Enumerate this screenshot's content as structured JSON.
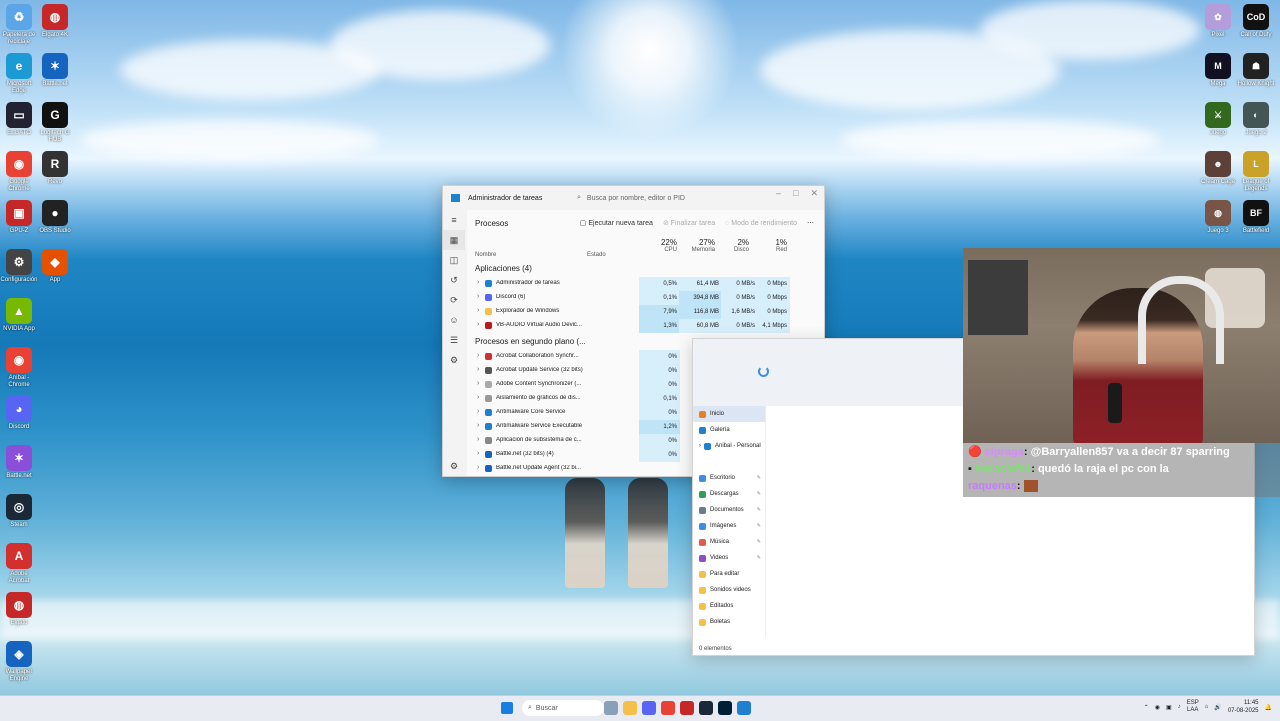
{
  "desktop": {
    "left_icons": [
      {
        "label": "Papelera de reciclaje",
        "color": "#5ba6e8",
        "glyph": "♻"
      },
      {
        "label": "Microsoft Edge",
        "color": "#1b9ad6",
        "glyph": "e"
      },
      {
        "label": "ELGATO",
        "color": "#223",
        "glyph": "▭"
      },
      {
        "label": "Google Chrome",
        "color": "#e94235",
        "glyph": "◉"
      },
      {
        "label": "GPU-Z",
        "color": "#c62828",
        "glyph": "▣"
      },
      {
        "label": "Configuración",
        "color": "#444",
        "glyph": "⚙"
      },
      {
        "label": "NVIDIA App",
        "color": "#76b900",
        "glyph": "▲"
      },
      {
        "label": "Aníbal - Chrome",
        "color": "#e94235",
        "glyph": "◉"
      },
      {
        "label": "Discord",
        "color": "#5865f2",
        "glyph": "◕"
      },
      {
        "label": "Battle.net",
        "color": "#8a4fd8",
        "glyph": "✶"
      },
      {
        "label": "Steam",
        "color": "#1b2838",
        "glyph": "◎"
      },
      {
        "label": "Adobe Acrobat",
        "color": "#d32f2f",
        "glyph": "A"
      },
      {
        "label": "Elgato",
        "color": "#c62828",
        "glyph": "◍"
      },
      {
        "label": "Wallpaper Engine",
        "color": "#1565c0",
        "glyph": "◈"
      }
    ],
    "left_icons_col2": [
      {
        "label": "Elgato 4K",
        "color": "#c62828",
        "glyph": "◍"
      },
      {
        "label": "Battle.net",
        "color": "#1565c0",
        "glyph": "✶"
      },
      {
        "label": "Logitech G HUB",
        "color": "#111",
        "glyph": "G"
      },
      {
        "label": "Revo",
        "color": "#333",
        "glyph": "R"
      },
      {
        "label": "OBS Studio",
        "color": "#222",
        "glyph": "●"
      },
      {
        "label": "App",
        "color": "#e65100",
        "glyph": "◆"
      }
    ],
    "right_icons": [
      {
        "label": "Pixel",
        "color": "#b39ddb",
        "glyph": "✿"
      },
      {
        "label": "Call of Duty",
        "color": "#111",
        "glyph": "CoD"
      },
      {
        "label": "Mega",
        "color": "#112",
        "glyph": "M"
      },
      {
        "label": "Hollow Knight",
        "color": "#222",
        "glyph": "☗"
      },
      {
        "label": "Juego",
        "color": "#33691e",
        "glyph": "⚔"
      },
      {
        "label": "Juego 2",
        "color": "#455",
        "glyph": "◐"
      },
      {
        "label": "Cream Cage",
        "color": "#5d4037",
        "glyph": "☻"
      },
      {
        "label": "League of Legends",
        "color": "#c9a227",
        "glyph": "L"
      },
      {
        "label": "Juego 3",
        "color": "#795548",
        "glyph": "◍"
      },
      {
        "label": "Battlefield",
        "color": "#111",
        "glyph": "BF"
      }
    ]
  },
  "task_manager": {
    "title": "Administrador de tareas",
    "search_placeholder": "Busca por nombre, editor o PID",
    "section": "Procesos",
    "toolbar": {
      "new_task": "Ejecutar nueva tarea",
      "end_task": "Finalizar tarea",
      "efficiency": "Modo de rendimiento",
      "more": "⋯"
    },
    "columns": {
      "name": "Nombre",
      "status": "Estado",
      "cpu": {
        "pct": "22%",
        "label": "CPU"
      },
      "mem": {
        "pct": "27%",
        "label": "Memoria"
      },
      "disk": {
        "pct": "2%",
        "label": "Disco"
      },
      "net": {
        "pct": "1%",
        "label": "Red"
      }
    },
    "apps_group": "Aplicaciones (4)",
    "apps": [
      {
        "name": "Administrador de tareas",
        "cpu": "0,5%",
        "mem": "61,4 MB",
        "disk": "0 MB/s",
        "net": "0 Mbps",
        "color": "#1f7fd1"
      },
      {
        "name": "Discord (6)",
        "cpu": "0,1%",
        "mem": "394,8 MB",
        "disk": "0 MB/s",
        "net": "0 Mbps",
        "color": "#5865f2"
      },
      {
        "name": "Explorador de Windows",
        "cpu": "7,9%",
        "mem": "116,8 MB",
        "disk": "1,6 MB/s",
        "net": "0 Mbps",
        "color": "#f5c04a"
      },
      {
        "name": "VB-AUDIO Virtual Audio Devic...",
        "cpu": "1,3%",
        "mem": "60,8 MB",
        "disk": "0 MB/s",
        "net": "4,1 Mbps",
        "color": "#b71c1c"
      }
    ],
    "bg_group": "Procesos en segundo plano (...",
    "bg": [
      {
        "name": "Acrobat Collaboration Synchr...",
        "cpu": "0%",
        "color": "#d32f2f"
      },
      {
        "name": "Acrobat Update Service (32 bits)",
        "cpu": "0%",
        "color": "#555"
      },
      {
        "name": "Adobe Content Synchronizer (...",
        "cpu": "0%",
        "color": "#aaa"
      },
      {
        "name": "Aislamiento de gráficos de dis...",
        "cpu": "0,1%",
        "color": "#999"
      },
      {
        "name": "Antimalware Core Service",
        "cpu": "0%",
        "color": "#1f7fd1"
      },
      {
        "name": "Antimalware Service Executable",
        "cpu": "1,2%",
        "color": "#1f7fd1"
      },
      {
        "name": "Aplicación de subsistema de c...",
        "cpu": "0%",
        "color": "#888"
      },
      {
        "name": "Battle.net (32 bits) (4)",
        "cpu": "0%",
        "color": "#1565c0"
      },
      {
        "name": "Battle.net Update Agent (32 bi...",
        "cpu": "",
        "color": "#1565c0"
      }
    ]
  },
  "explorer": {
    "nav": [
      {
        "label": "Inicio",
        "color": "#e67e22",
        "pin": false,
        "sel": true
      },
      {
        "label": "Galería",
        "color": "#1f7fd1",
        "pin": false,
        "sel": false
      },
      {
        "label": "Anibal - Personal",
        "color": "#1f7fd1",
        "pin": false,
        "sel": false,
        "expander": true
      },
      {
        "label": "",
        "color": "",
        "pin": false,
        "sel": false,
        "spacer": true
      },
      {
        "label": "Escritorio",
        "color": "#3a8ee6",
        "pin": true,
        "sel": false
      },
      {
        "label": "Descargas",
        "color": "#2e9e5b",
        "pin": true,
        "sel": false
      },
      {
        "label": "Documentos",
        "color": "#6b7b8c",
        "pin": true,
        "sel": false
      },
      {
        "label": "Imágenes",
        "color": "#3a8ee6",
        "pin": true,
        "sel": false
      },
      {
        "label": "Música",
        "color": "#e25b4a",
        "pin": true,
        "sel": false
      },
      {
        "label": "Videos",
        "color": "#8b4fc8",
        "pin": true,
        "sel": false
      },
      {
        "label": "Para editar",
        "color": "#f5c04a",
        "pin": false,
        "sel": false
      },
      {
        "label": "Sonidos videos",
        "color": "#f5c04a",
        "pin": false,
        "sel": false
      },
      {
        "label": "Editados",
        "color": "#f5c04a",
        "pin": false,
        "sel": false
      },
      {
        "label": "Boletas",
        "color": "#f5c04a",
        "pin": false,
        "sel": false
      }
    ],
    "status": "0 elementos"
  },
  "chat": [
    {
      "user": "elpraga",
      "message": "@Barryallen857 va a decir 87 sparring"
    },
    {
      "user": "Horaciof11",
      "message": "quedó la raja el pc con la"
    },
    {
      "user": "raquenas",
      "message": ""
    }
  ],
  "taskbar": {
    "search": "Buscar",
    "apps": [
      "#8aa0b8",
      "#f5c04a",
      "#5865f2",
      "#e94235",
      "#c62828",
      "#1b2838",
      "#001e36",
      "#1f7fd1"
    ],
    "lang": "ESP",
    "lang2": "LAA",
    "time": "11:45",
    "date": "07-08-2025"
  },
  "colors": {
    "accent": "#1f7fd1",
    "highlight": "#bfe3f7"
  }
}
